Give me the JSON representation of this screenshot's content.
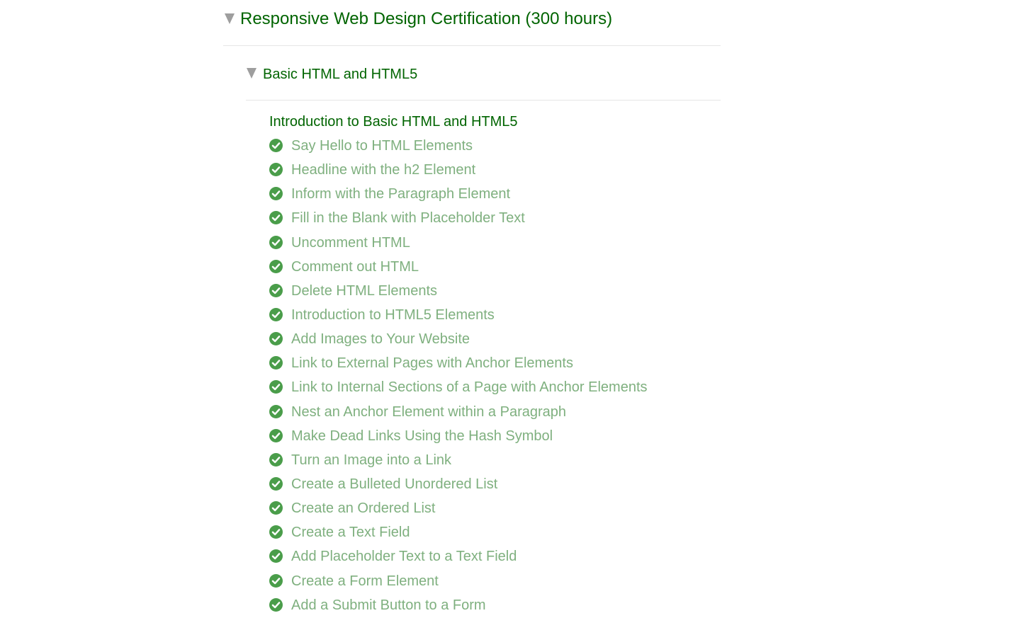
{
  "certification": {
    "title": "Responsive Web Design Certification (300 hours)",
    "expanded": true
  },
  "block": {
    "title": "Basic HTML and HTML5",
    "expanded": true
  },
  "intro": {
    "label": "Introduction to Basic HTML and HTML5"
  },
  "colors": {
    "title_green": "#006400",
    "completed_text": "#7fb07f",
    "check_green": "#4a9d4a",
    "arrow_gray": "#9e9e9e",
    "divider": "#e6e6e6"
  },
  "challenges": [
    {
      "label": "Say Hello to HTML Elements",
      "completed": true,
      "icon": "check-circle-icon"
    },
    {
      "label": "Headline with the h2 Element",
      "completed": true,
      "icon": "check-circle-icon"
    },
    {
      "label": "Inform with the Paragraph Element",
      "completed": true,
      "icon": "check-circle-icon"
    },
    {
      "label": "Fill in the Blank with Placeholder Text",
      "completed": true,
      "icon": "check-circle-icon"
    },
    {
      "label": "Uncomment HTML",
      "completed": true,
      "icon": "check-circle-icon"
    },
    {
      "label": "Comment out HTML",
      "completed": true,
      "icon": "check-circle-icon"
    },
    {
      "label": "Delete HTML Elements",
      "completed": true,
      "icon": "check-circle-icon"
    },
    {
      "label": "Introduction to HTML5 Elements",
      "completed": true,
      "icon": "check-circle-icon"
    },
    {
      "label": "Add Images to Your Website",
      "completed": true,
      "icon": "check-circle-icon"
    },
    {
      "label": "Link to External Pages with Anchor Elements",
      "completed": true,
      "icon": "check-circle-icon"
    },
    {
      "label": "Link to Internal Sections of a Page with Anchor Elements",
      "completed": true,
      "icon": "check-circle-icon"
    },
    {
      "label": "Nest an Anchor Element within a Paragraph",
      "completed": true,
      "icon": "check-circle-icon"
    },
    {
      "label": "Make Dead Links Using the Hash Symbol",
      "completed": true,
      "icon": "check-circle-icon"
    },
    {
      "label": "Turn an Image into a Link",
      "completed": true,
      "icon": "check-circle-icon"
    },
    {
      "label": "Create a Bulleted Unordered List",
      "completed": true,
      "icon": "check-circle-icon"
    },
    {
      "label": "Create an Ordered List",
      "completed": true,
      "icon": "check-circle-icon"
    },
    {
      "label": "Create a Text Field",
      "completed": true,
      "icon": "check-circle-icon"
    },
    {
      "label": "Add Placeholder Text to a Text Field",
      "completed": true,
      "icon": "check-circle-icon"
    },
    {
      "label": "Create a Form Element",
      "completed": true,
      "icon": "check-circle-icon"
    },
    {
      "label": "Add a Submit Button to a Form",
      "completed": true,
      "icon": "check-circle-icon"
    }
  ]
}
